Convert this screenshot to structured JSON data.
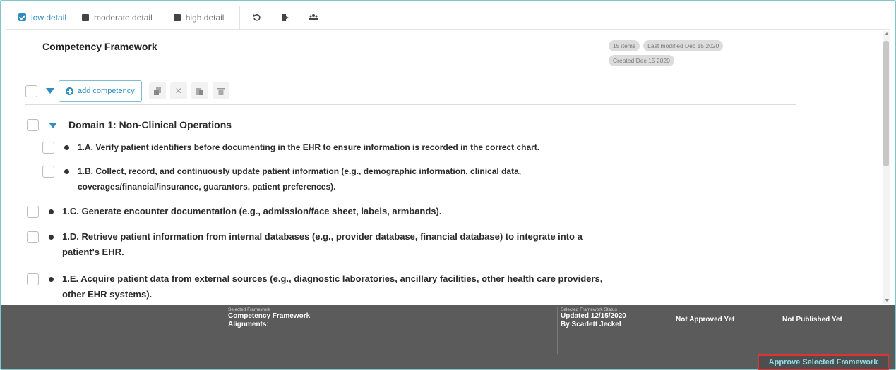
{
  "toolbar": {
    "detail_levels": [
      {
        "label": "low detail",
        "checked": true
      },
      {
        "label": "moderate detail",
        "checked": false
      },
      {
        "label": "high detail",
        "checked": false
      }
    ],
    "icons": [
      "undo-icon",
      "export-icon",
      "users-icon"
    ]
  },
  "framework": {
    "title": "Competency Framework",
    "chips": [
      "15 items",
      "Last modified Dec 15 2020",
      "Created Dec 15 2020"
    ]
  },
  "actions": {
    "add_label": "add competency",
    "icons": [
      "copy-icon",
      "cut-icon",
      "paste-icon",
      "delete-icon"
    ]
  },
  "items": [
    {
      "type": "domain",
      "text": "Domain 1: Non-Clinical Operations"
    },
    {
      "type": "competency",
      "lines": [
        "1.A. Verify patient identifiers before documenting in the EHR to ensure information is recorded in the correct chart."
      ]
    },
    {
      "type": "competency",
      "lines": [
        "1.B. Collect, record, and continuously update patient information (e.g., demographic information, clinical data,",
        "coverages/financial/insurance, guarantors, patient preferences)."
      ]
    },
    {
      "type": "competency",
      "lines": [
        "1.C. Generate encounter documentation (e.g., admission/face sheet, labels, armbands)."
      ]
    },
    {
      "type": "competency",
      "lines": [
        "1.D. Retrieve patient information from internal databases (e.g., provider database, financial database) to integrate into a",
        "patient's EHR."
      ]
    },
    {
      "type": "competency",
      "lines": [
        "1.E. Acquire patient data from external sources (e.g., diagnostic laboratories, ancillary facilities, other health care providers,",
        "other EHR systems)."
      ]
    }
  ],
  "footer": {
    "selected_framework_label": "Selected Framework",
    "selected_framework_name": "Competency Framework",
    "alignments_label": "Alignments:",
    "status_label": "Selected Framework Status",
    "updated": "Updated 12/15/2020",
    "by": "By Scarlett Jeckel",
    "approval_status": "Not Approved Yet",
    "publish_status": "Not Published Yet",
    "approve_button": "Approve Selected Framework"
  },
  "colors": {
    "accent": "#2e8fbf",
    "footer_bg": "#5b5b5b",
    "approve_text": "#8fdde6",
    "highlight_border": "#dd3333"
  }
}
